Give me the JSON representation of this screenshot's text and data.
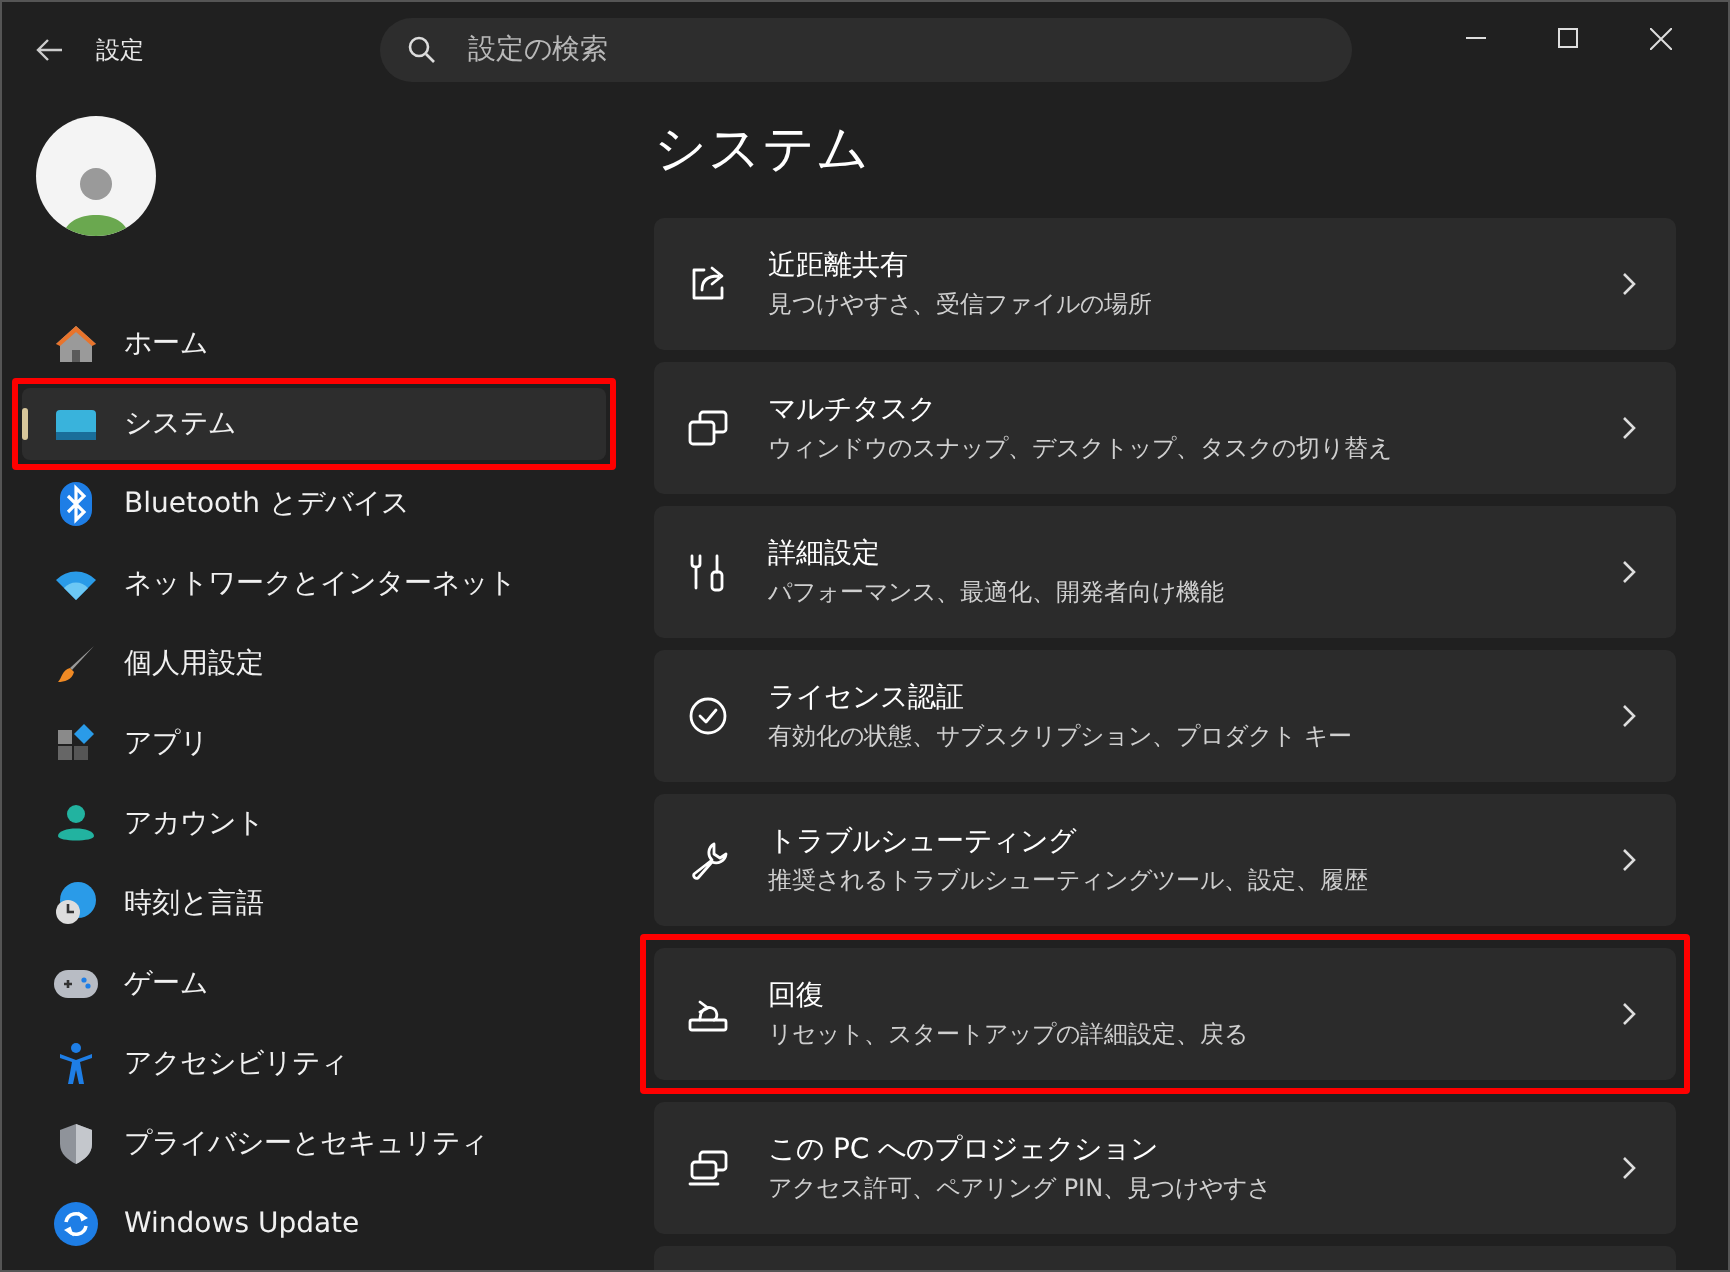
{
  "window": {
    "title": "設定"
  },
  "search": {
    "placeholder": "設定の検索"
  },
  "sidebar": {
    "items": [
      {
        "label": "ホーム",
        "selected": false,
        "highlighted": false
      },
      {
        "label": "システム",
        "selected": true,
        "highlighted": true
      },
      {
        "label": "Bluetooth とデバイス",
        "selected": false,
        "highlighted": false
      },
      {
        "label": "ネットワークとインターネット",
        "selected": false,
        "highlighted": false
      },
      {
        "label": "個人用設定",
        "selected": false,
        "highlighted": false
      },
      {
        "label": "アプリ",
        "selected": false,
        "highlighted": false
      },
      {
        "label": "アカウント",
        "selected": false,
        "highlighted": false
      },
      {
        "label": "時刻と言語",
        "selected": false,
        "highlighted": false
      },
      {
        "label": "ゲーム",
        "selected": false,
        "highlighted": false
      },
      {
        "label": "アクセシビリティ",
        "selected": false,
        "highlighted": false
      },
      {
        "label": "プライバシーとセキュリティ",
        "selected": false,
        "highlighted": false
      },
      {
        "label": "Windows Update",
        "selected": false,
        "highlighted": false
      }
    ]
  },
  "page": {
    "heading": "システム",
    "cards": [
      {
        "title": "近距離共有",
        "subtitle": "見つけやすさ、受信ファイルの場所",
        "highlighted": false
      },
      {
        "title": "マルチタスク",
        "subtitle": "ウィンドウのスナップ、デスクトップ、タスクの切り替え",
        "highlighted": false
      },
      {
        "title": "詳細設定",
        "subtitle": "パフォーマンス、最適化、開発者向け機能",
        "highlighted": false
      },
      {
        "title": "ライセンス認証",
        "subtitle": "有効化の状態、サブスクリプション、プロダクト キー",
        "highlighted": false
      },
      {
        "title": "トラブルシューティング",
        "subtitle": "推奨されるトラブルシューティングツール、設定、履歴",
        "highlighted": false
      },
      {
        "title": "回復",
        "subtitle": "リセット、スタートアップの詳細設定、戻る",
        "highlighted": true
      },
      {
        "title": "この PC へのプロジェクション",
        "subtitle": "アクセス許可、ペアリング PIN、見つけやすさ",
        "highlighted": false
      }
    ]
  }
}
